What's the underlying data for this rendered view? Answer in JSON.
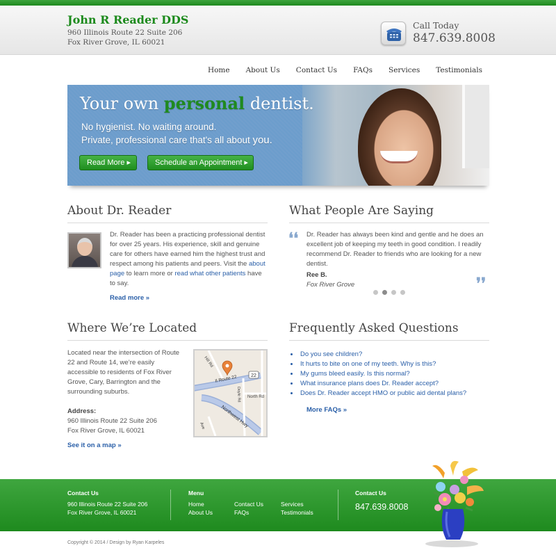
{
  "header": {
    "title": "John R Reader DDS",
    "address_line1": "960 Illinois Route 22 Suite 206",
    "address_line2": "Fox River Grove, IL 60021",
    "call_label": "Call Today",
    "phone": "847.639.8008"
  },
  "nav": [
    "Home",
    "About Us",
    "Contact Us",
    "FAQs",
    "Services",
    "Testimonials"
  ],
  "hero": {
    "title_pre": "Your own ",
    "title_accent": "personal",
    "title_post": " dentist.",
    "line1": "No hygienist. No waiting around.",
    "line2_pre": "Private, professional care that's all about ",
    "line2_you": "you.",
    "read_more": "Read More ▸",
    "schedule": "Schedule an Appointment ▸"
  },
  "about": {
    "heading": "About Dr. Reader",
    "text1": "Dr. Reader has been a practicing professional dentist for over 25 years. His experience, skill and genuine care for others have earned him the highest trust and respect among his patients and peers. Visit the ",
    "link1": "about page",
    "text2": " to learn more or ",
    "link2": "read what other patients",
    "text3": " have to say.",
    "read_more": "Read more »"
  },
  "testimonials": {
    "heading": "What People Are Saying",
    "quote": "Dr. Reader has always been kind and gentle and he does an excellent job of keeping my teeth in good condition. I readily recommend Dr. Reader to friends who are looking for a new dentist.",
    "author": "Ree B.",
    "location": "Fox River Grove",
    "slide_count": 4,
    "active_slide": 2
  },
  "location": {
    "heading": "Where We’re Located",
    "text": "Located near the intersection of Route 22 and Route 14, we’re easily accessible to residents of Fox River Grove, Cary, Barrington and the surrounding suburbs.",
    "address_label": "Address:",
    "address_line1": "960 Illinois Route 22 Suite 206",
    "address_line2": "Fox River Grove, IL 60021",
    "map_link": "See it on a map »",
    "map_labels": {
      "hill": "Hill Rd",
      "route22": "Il Route 22",
      "shield": "22",
      "doyle": "Doyle Rd",
      "north": "North Rd",
      "northwest": "Northwest Hwy",
      "ave": "Ave"
    }
  },
  "faq": {
    "heading": "Frequently Asked Questions",
    "items": [
      "Do you see children?",
      "It hurts to bite on one of my teeth. Why is this?",
      "My gums bleed easily. Is this normal?",
      "What insurance plans does Dr. Reader accept?",
      "Does Dr. Reader accept HMO or public aid dental plans?"
    ],
    "more": "More FAQs »"
  },
  "footer": {
    "contact_heading": "Contact Us",
    "address_line1": "960 Illinois Route 22 Suite 206",
    "address_line2": "Fox River Grove, IL 60021",
    "menu_heading": "Menu",
    "menu": [
      "Home",
      "About Us",
      "Contact Us",
      "FAQs",
      "Services",
      "Testimonials"
    ],
    "contact_heading2": "Contact Us",
    "phone": "847.639.8008",
    "copyright": "Copyright © 2014 / Design by Ryan Karpeles"
  },
  "colors": {
    "brand_green": "#1f8a1f",
    "link_blue": "#2a5fa8",
    "hero_blue": "#6e9fcf"
  }
}
